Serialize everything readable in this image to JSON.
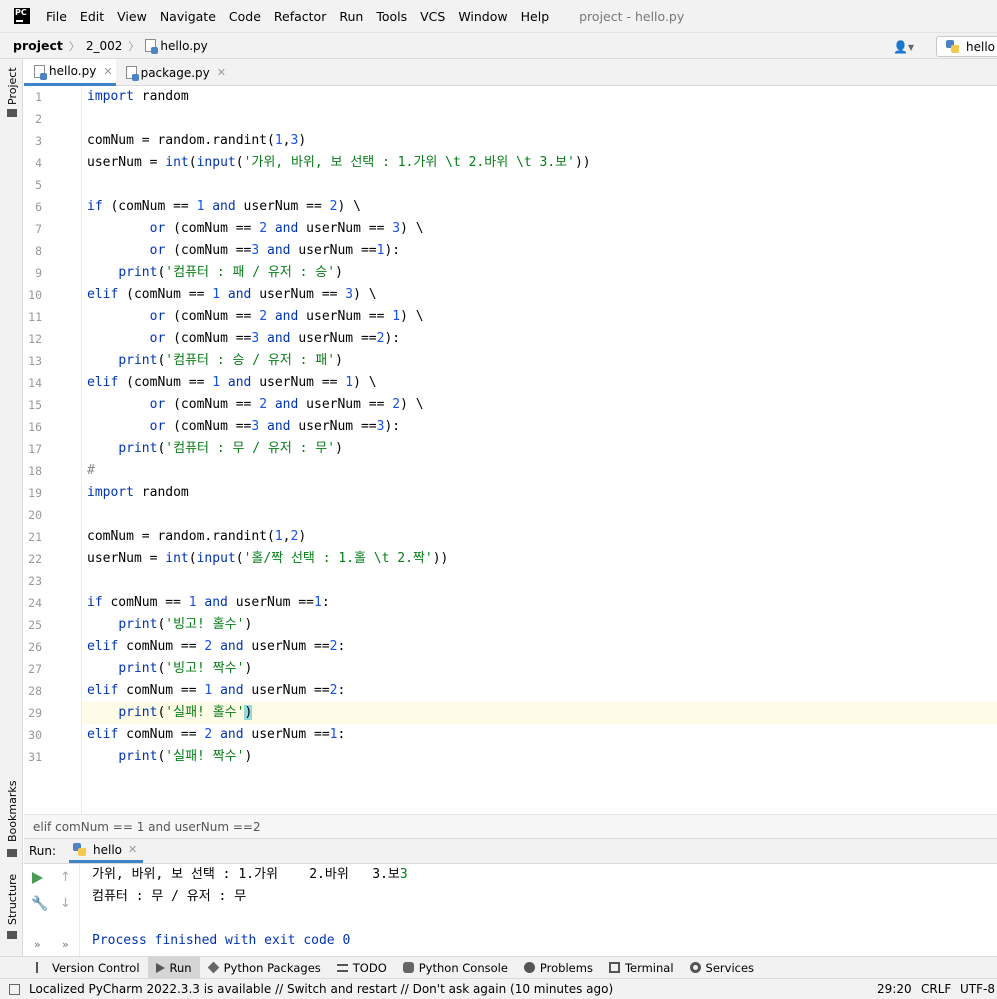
{
  "menu": {
    "logo_text": "PC",
    "items": [
      "File",
      "Edit",
      "View",
      "Navigate",
      "Code",
      "Refactor",
      "Run",
      "Tools",
      "VCS",
      "Window",
      "Help"
    ],
    "title": "project - hello.py"
  },
  "navbar": {
    "project": "project",
    "folder": "2_002",
    "file": "hello.py",
    "run_config": "hello"
  },
  "left_strip": {
    "project": "Project",
    "bookmarks": "Bookmarks",
    "structure": "Structure"
  },
  "tabs": [
    {
      "label": "hello.py",
      "active": true
    },
    {
      "label": "package.py",
      "active": false
    }
  ],
  "editor": {
    "line_numbers": [
      "1",
      "2",
      "3",
      "4",
      "5",
      "6",
      "7",
      "8",
      "9",
      "10",
      "11",
      "12",
      "13",
      "14",
      "15",
      "16",
      "17",
      "18",
      "19",
      "20",
      "21",
      "22",
      "23",
      "24",
      "25",
      "26",
      "27",
      "28",
      "29",
      "30",
      "31"
    ],
    "caret_line": 29,
    "lines": [
      "import random",
      "",
      "comNum = random.randint(1,3)",
      "userNum = int(input('가위, 바위, 보 선택 : 1.가위 \\t 2.바위 \\t 3.보'))",
      "",
      "if (comNum == 1 and userNum == 2) \\",
      "        or (comNum == 2 and userNum == 3) \\",
      "        or (comNum ==3 and userNum ==1):",
      "    print('컴퓨터 : 패 / 유저 : 승')",
      "elif (comNum == 1 and userNum == 3) \\",
      "        or (comNum == 2 and userNum == 1) \\",
      "        or (comNum ==3 and userNum ==2):",
      "    print('컴퓨터 : 승 / 유저 : 패')",
      "elif (comNum == 1 and userNum == 1) \\",
      "        or (comNum == 2 and userNum == 2) \\",
      "        or (comNum ==3 and userNum ==3):",
      "    print('컴퓨터 : 무 / 유저 : 무')",
      "#",
      "import random",
      "",
      "comNum = random.randint(1,2)",
      "userNum = int(input('홀/짝 선택 : 1.홀 \\t 2.짝'))",
      "",
      "if comNum == 1 and userNum ==1:",
      "    print('빙고! 홀수')",
      "elif comNum == 2 and userNum ==2:",
      "    print('빙고! 짝수')",
      "elif comNum == 1 and userNum ==2:",
      "    print('실패! 홀수')",
      "elif comNum == 2 and userNum ==1:",
      "    print('실패! 짝수')"
    ]
  },
  "breadcrumb": "elif comNum == 1 and userNum ==2",
  "run": {
    "label": "Run:",
    "tab": "hello",
    "output": [
      "가위, 바위, 보 선택 : 1.가위    2.바위   3.보",
      "컴퓨터 : 무 / 유저 : 무",
      "",
      "Process finished with exit code 0"
    ],
    "input_echo": "3"
  },
  "bottom_tools": [
    "Version Control",
    "Run",
    "Python Packages",
    "TODO",
    "Python Console",
    "Problems",
    "Terminal",
    "Services"
  ],
  "status": {
    "message": "Localized PyCharm 2022.3.3 is available // Switch and restart // Don't ask again (10 minutes ago)",
    "position": "29:20",
    "line_sep": "CRLF",
    "encoding": "UTF-8"
  },
  "colors": {
    "keyword": "#0033b3",
    "number": "#1750eb",
    "string": "#067d17",
    "accent": "#4083c9"
  }
}
